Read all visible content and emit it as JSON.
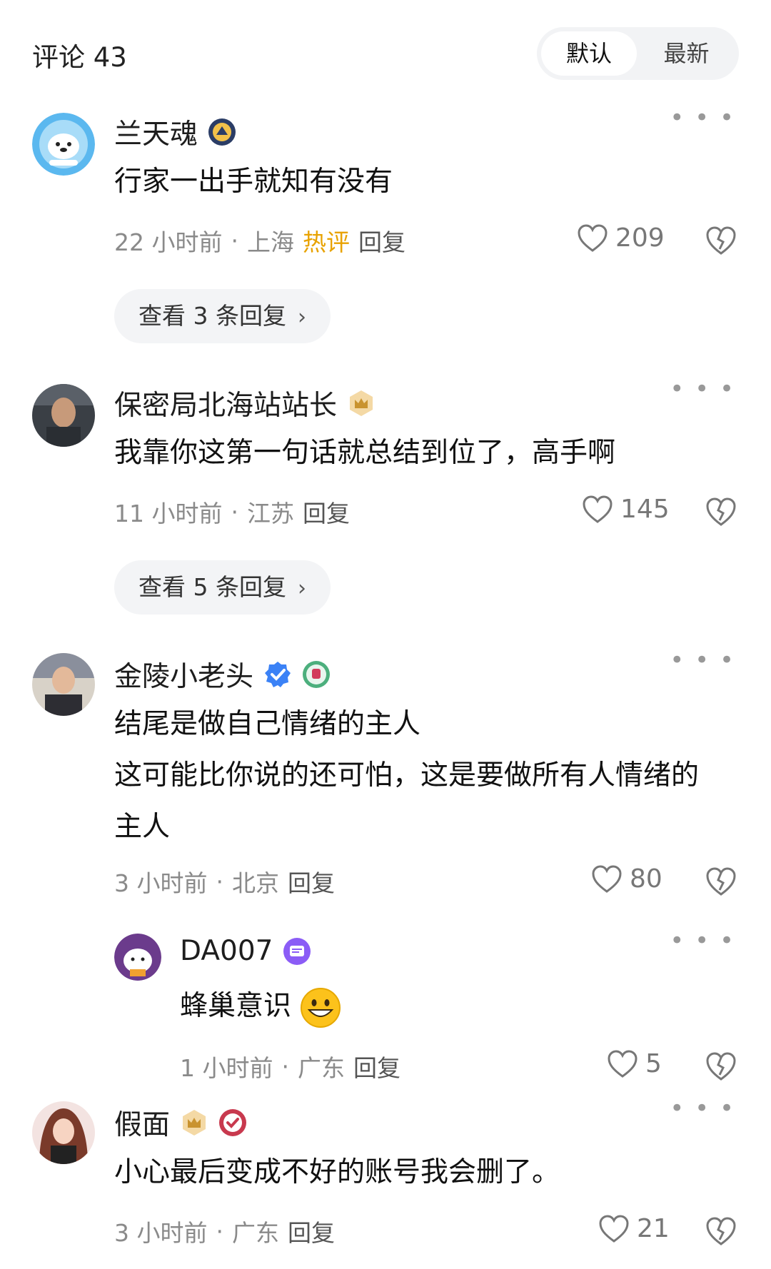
{
  "header": {
    "title": "评论 43",
    "sort_default": "默认",
    "sort_latest": "最新"
  },
  "comments": [
    {
      "username": "兰天魂",
      "text": "行家一出手就知有没有",
      "time": "22 小时前",
      "location": "上海",
      "hot": "热评",
      "reply": "回复",
      "likes": "209",
      "view_replies": "查看 3 条回复"
    },
    {
      "username": "保密局北海站站长",
      "text": "我靠你这第一句话就总结到位了，高手啊",
      "time": "11 小时前",
      "location": "江苏",
      "reply": "回复",
      "likes": "145",
      "view_replies": "查看 5 条回复"
    },
    {
      "username": "金陵小老头",
      "text_lines": [
        "结尾是做自己情绪的主人",
        "这可能比你说的还可怕，这是要做所有人情绪的",
        "主人"
      ],
      "time": "3 小时前",
      "location": "北京",
      "reply": "回复",
      "likes": "80"
    },
    {
      "username": "DA007",
      "text": "蜂巢意识",
      "time": "1 小时前",
      "location": "广东",
      "reply": "回复",
      "likes": "5"
    },
    {
      "username": "假面",
      "text": "小心最后变成不好的账号我会删了。",
      "time": "3 小时前",
      "location": "广东",
      "reply": "回复",
      "likes": "21"
    }
  ],
  "icons": {
    "more": "more-icon",
    "like": "heart-icon",
    "dislike": "broken-heart-icon",
    "chevron": "chevron-right-icon"
  },
  "colors": {
    "hot": "#e8a200",
    "verified": "#3b82f6"
  }
}
